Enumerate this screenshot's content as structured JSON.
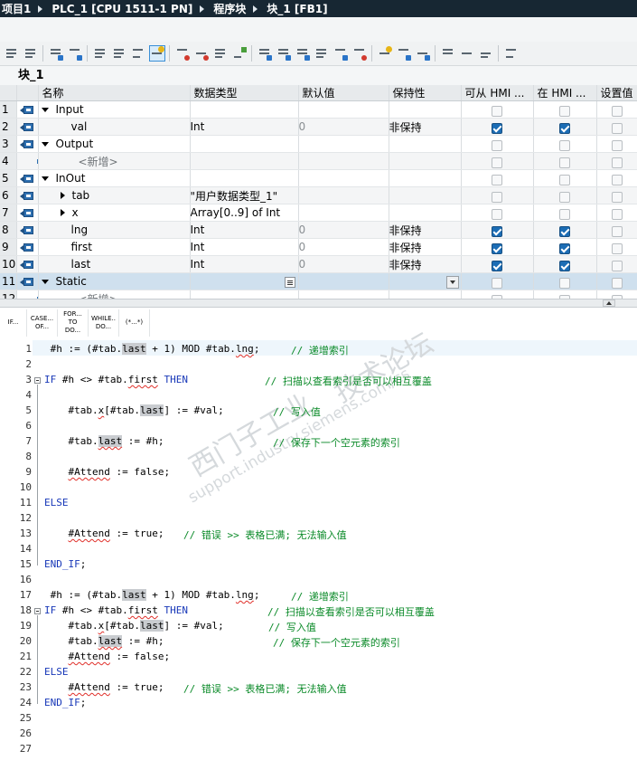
{
  "breadcrumb": [
    "项目1",
    "PLC_1 [CPU 1511-1 PN]",
    "程序块",
    "块_1 [FB1]"
  ],
  "block_title": "块_1",
  "table": {
    "headers": [
      "",
      "名称",
      "数据类型",
      "默认值",
      "保持性",
      "可从 HMI ...",
      "在 HMI ...",
      "设置值"
    ],
    "rows": [
      {
        "num": "1",
        "name": "Input",
        "type": "",
        "default": "",
        "retain": ""
      },
      {
        "num": "2",
        "name": "val",
        "type": "Int",
        "default": "0",
        "retain": "非保持"
      },
      {
        "num": "3",
        "name": "Output",
        "type": "",
        "default": "",
        "retain": ""
      },
      {
        "num": "4",
        "name": "<新增>",
        "type": "",
        "default": "",
        "retain": ""
      },
      {
        "num": "5",
        "name": "InOut",
        "type": "",
        "default": "",
        "retain": ""
      },
      {
        "num": "6",
        "name": "tab",
        "type": "\"用户数据类型_1\"",
        "default": "",
        "retain": ""
      },
      {
        "num": "7",
        "name": "x",
        "type": "Array[0..9] of Int",
        "default": "",
        "retain": ""
      },
      {
        "num": "8",
        "name": "lng",
        "type": "Int",
        "default": "0",
        "retain": "非保持"
      },
      {
        "num": "9",
        "name": "first",
        "type": "Int",
        "default": "0",
        "retain": "非保持"
      },
      {
        "num": "10",
        "name": "last",
        "type": "Int",
        "default": "0",
        "retain": "非保持"
      },
      {
        "num": "11",
        "name": "Static",
        "type": "",
        "default": "",
        "retain": ""
      },
      {
        "num": "12",
        "name": "<新增>",
        "type": "",
        "default": "",
        "retain": ""
      }
    ]
  },
  "instructions": [
    {
      "line1": "IF...",
      "line2": ""
    },
    {
      "line1": "CASE...",
      "line2": "OF..."
    },
    {
      "line1": "FOR...",
      "line2": "TO DO..."
    },
    {
      "line1": "WHILE..",
      "line2": "DO..."
    },
    {
      "line1": "(*...*)",
      "line2": ""
    }
  ],
  "code": {
    "line_numbers": [
      "1",
      "2",
      "3",
      "4",
      "5",
      "6",
      "7",
      "8",
      "9",
      "10",
      "11",
      "12",
      "13",
      "14",
      "15",
      "16",
      "17",
      "18",
      "19",
      "20",
      "21",
      "22",
      "23",
      "24",
      "25",
      "26",
      "27"
    ],
    "comments": {
      "c1": "// 递增索引",
      "c3": "// 扫描以查看索引是否可以相互覆盖",
      "c5": "// 写入值",
      "c7": "// 保存下一个空元素的索引",
      "c13": "// 错误 >> 表格已满; 无法输入值",
      "c17": "// 递增索引",
      "c18": "// 扫描以查看索引是否可以相互覆盖",
      "c19": "// 写入值",
      "c20": "// 保存下一个空元素的索引",
      "c23": "// 错误 >> 表格已满; 无法输入值"
    }
  },
  "watermark": {
    "line1": "西门子工业",
    "line2": "技术论坛",
    "line3": "support.industry.siemens.com/cs"
  }
}
